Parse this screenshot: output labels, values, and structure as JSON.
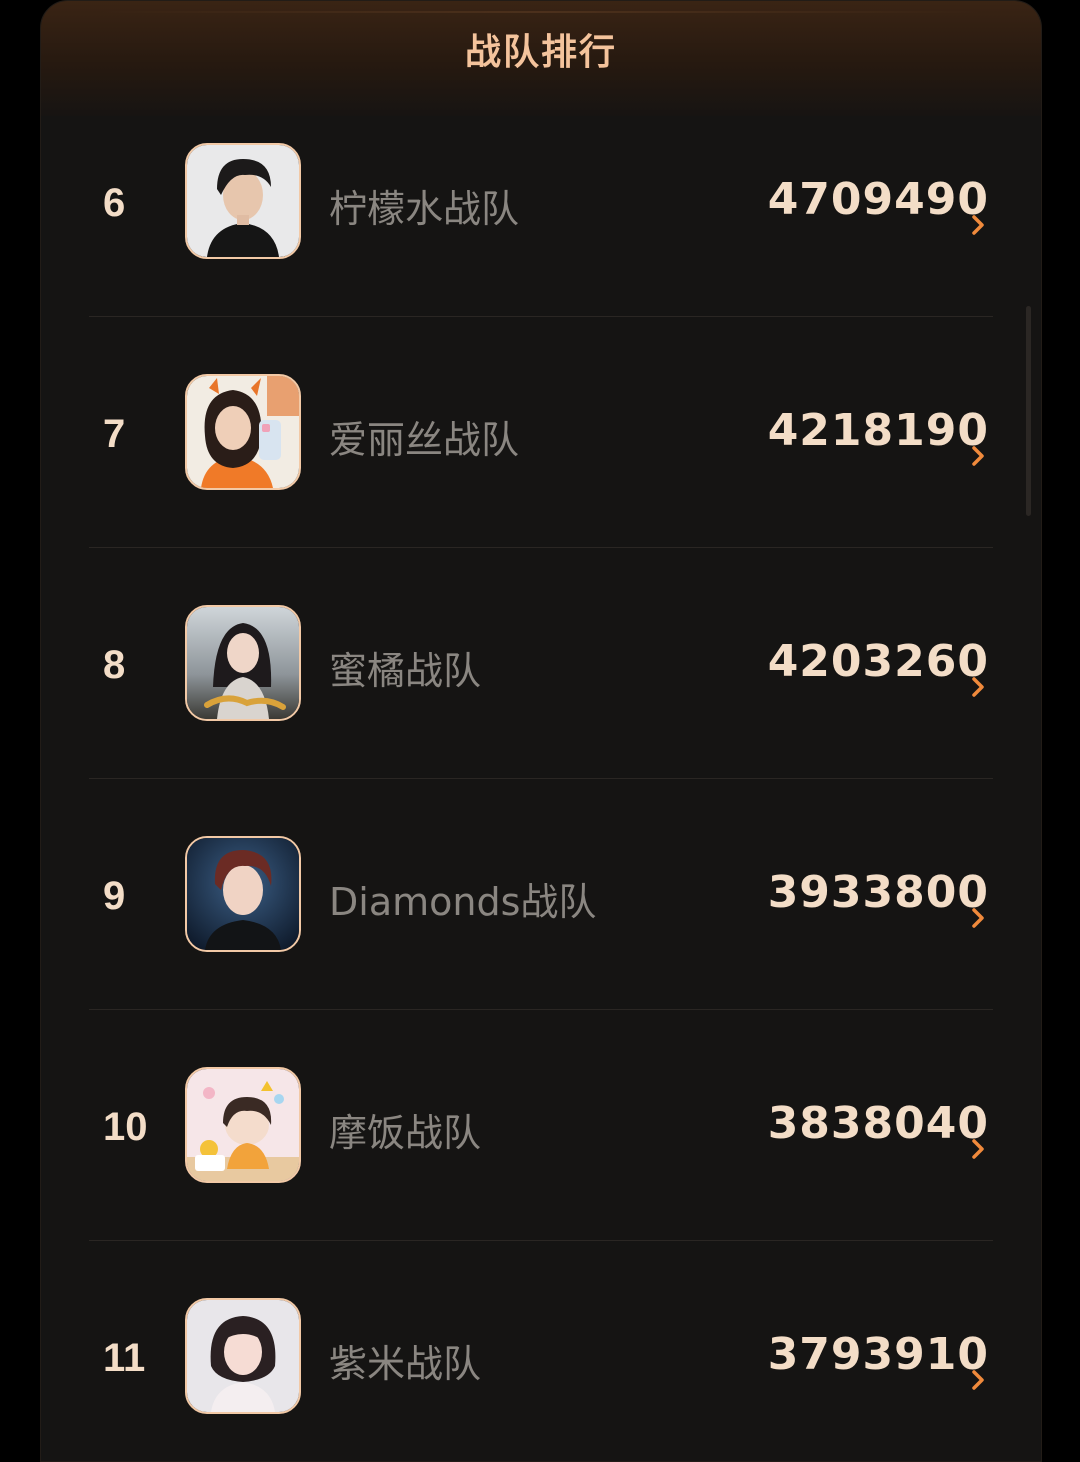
{
  "header": {
    "title": "战队排行"
  },
  "teams": [
    {
      "rank": "6",
      "name": "柠檬水战队",
      "score": "4709490",
      "avatar_icon": "avatar-male-dark-hair-icon"
    },
    {
      "rank": "7",
      "name": "爱丽丝战队",
      "score": "4218190",
      "avatar_icon": "avatar-female-selfie-icon"
    },
    {
      "rank": "8",
      "name": "蜜橘战队",
      "score": "4203260",
      "avatar_icon": "avatar-drama-poster-icon"
    },
    {
      "rank": "9",
      "name": "Diamonds战队",
      "score": "3933800",
      "avatar_icon": "avatar-male-red-hair-icon"
    },
    {
      "rank": "10",
      "name": "摩饭战队",
      "score": "3838040",
      "avatar_icon": "avatar-cartoon-icon"
    },
    {
      "rank": "11",
      "name": "紫米战队",
      "score": "3793910",
      "avatar_icon": "avatar-female-light-icon"
    }
  ],
  "colors": {
    "accent": "#f4c39c",
    "chevron": "#f08a3c",
    "text_primary": "#f3ddc7",
    "text_secondary": "#8a8681",
    "background": "#151413"
  }
}
